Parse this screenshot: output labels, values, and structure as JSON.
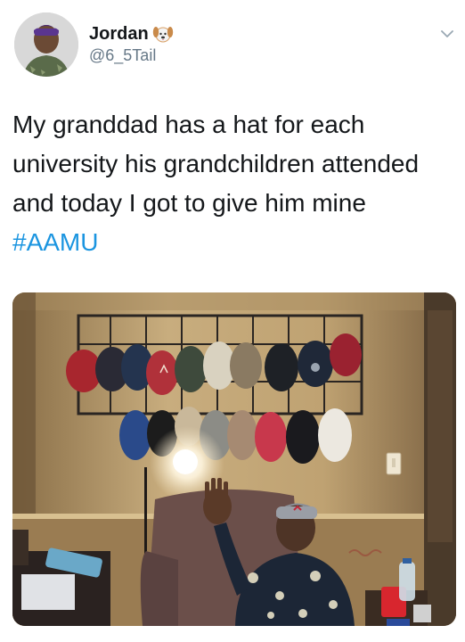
{
  "author": {
    "display_name": "Jordan",
    "name_emoji": "dog-face-icon",
    "handle": "@6_5Tail"
  },
  "tweet": {
    "text_before_hashtag": "My granddad has a hat for each university his grandchildren attended and today I got to give him mine ",
    "hashtag": "#AAMU"
  },
  "media": {
    "description_icon": "photo",
    "colors": {
      "wall": "#b79a6c",
      "rack": "#2a2522",
      "chair": "#6b4f4a"
    }
  },
  "colors": {
    "text": "#14171a",
    "secondary": "#657786",
    "link": "#1b95e0"
  }
}
